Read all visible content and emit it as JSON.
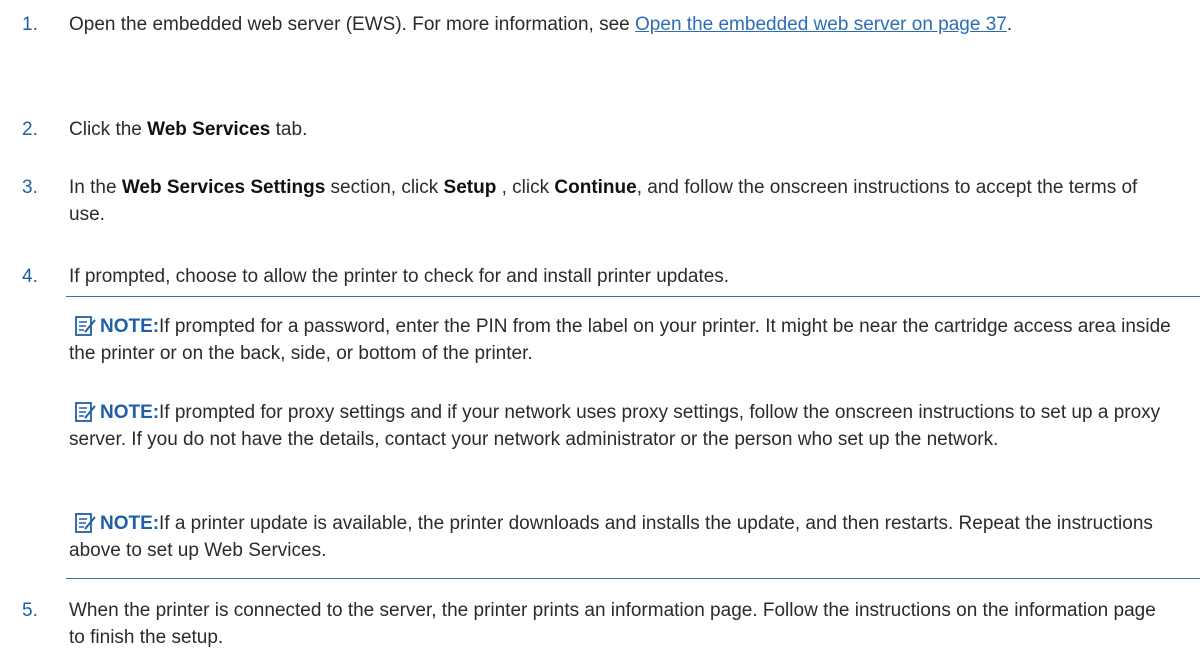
{
  "steps": [
    {
      "num": "1.",
      "before": "Open the embedded web server (EWS). For more information, see ",
      "link": "Open the embedded web server on page 37",
      "after": "."
    },
    {
      "num": "2.",
      "t1": "Click the ",
      "b1": "Web Services",
      "t2": " tab."
    },
    {
      "num": "3.",
      "t1": "In the ",
      "b1": "Web Services Settings",
      "t2": " section, click ",
      "b2": "Setup",
      "t3": " , click ",
      "b3": "Continue",
      "t4": ", and follow the onscreen instructions to accept the terms of use."
    },
    {
      "num": "4.",
      "text": "If prompted, choose to allow the printer to check for and install printer updates."
    },
    {
      "num": "5.",
      "text": "When the printer is connected to the server, the printer prints an information page. Follow the instructions on the information page to finish the setup."
    }
  ],
  "notes": [
    {
      "label": "NOTE:",
      "text": "If prompted for a password, enter the PIN from the label on your printer. It might be near the cartridge access area inside the printer or on the back, side, or bottom of the printer."
    },
    {
      "label": "NOTE:",
      "text": "If prompted for proxy settings and if your network uses proxy settings, follow the onscreen instructions to set up a proxy server. If you do not have the details, contact your network administrator or the person who set up the network."
    },
    {
      "label": "NOTE:",
      "text": "If a printer update is available, the printer downloads and installs the update, and then restarts. Repeat the instructions above to set up Web Services."
    }
  ],
  "icons": {
    "note": "note-icon"
  },
  "colors": {
    "accent": "#1f5fa8",
    "link": "#2d6db5",
    "rule": "#3a6ea5",
    "text": "#2b2b2b"
  }
}
